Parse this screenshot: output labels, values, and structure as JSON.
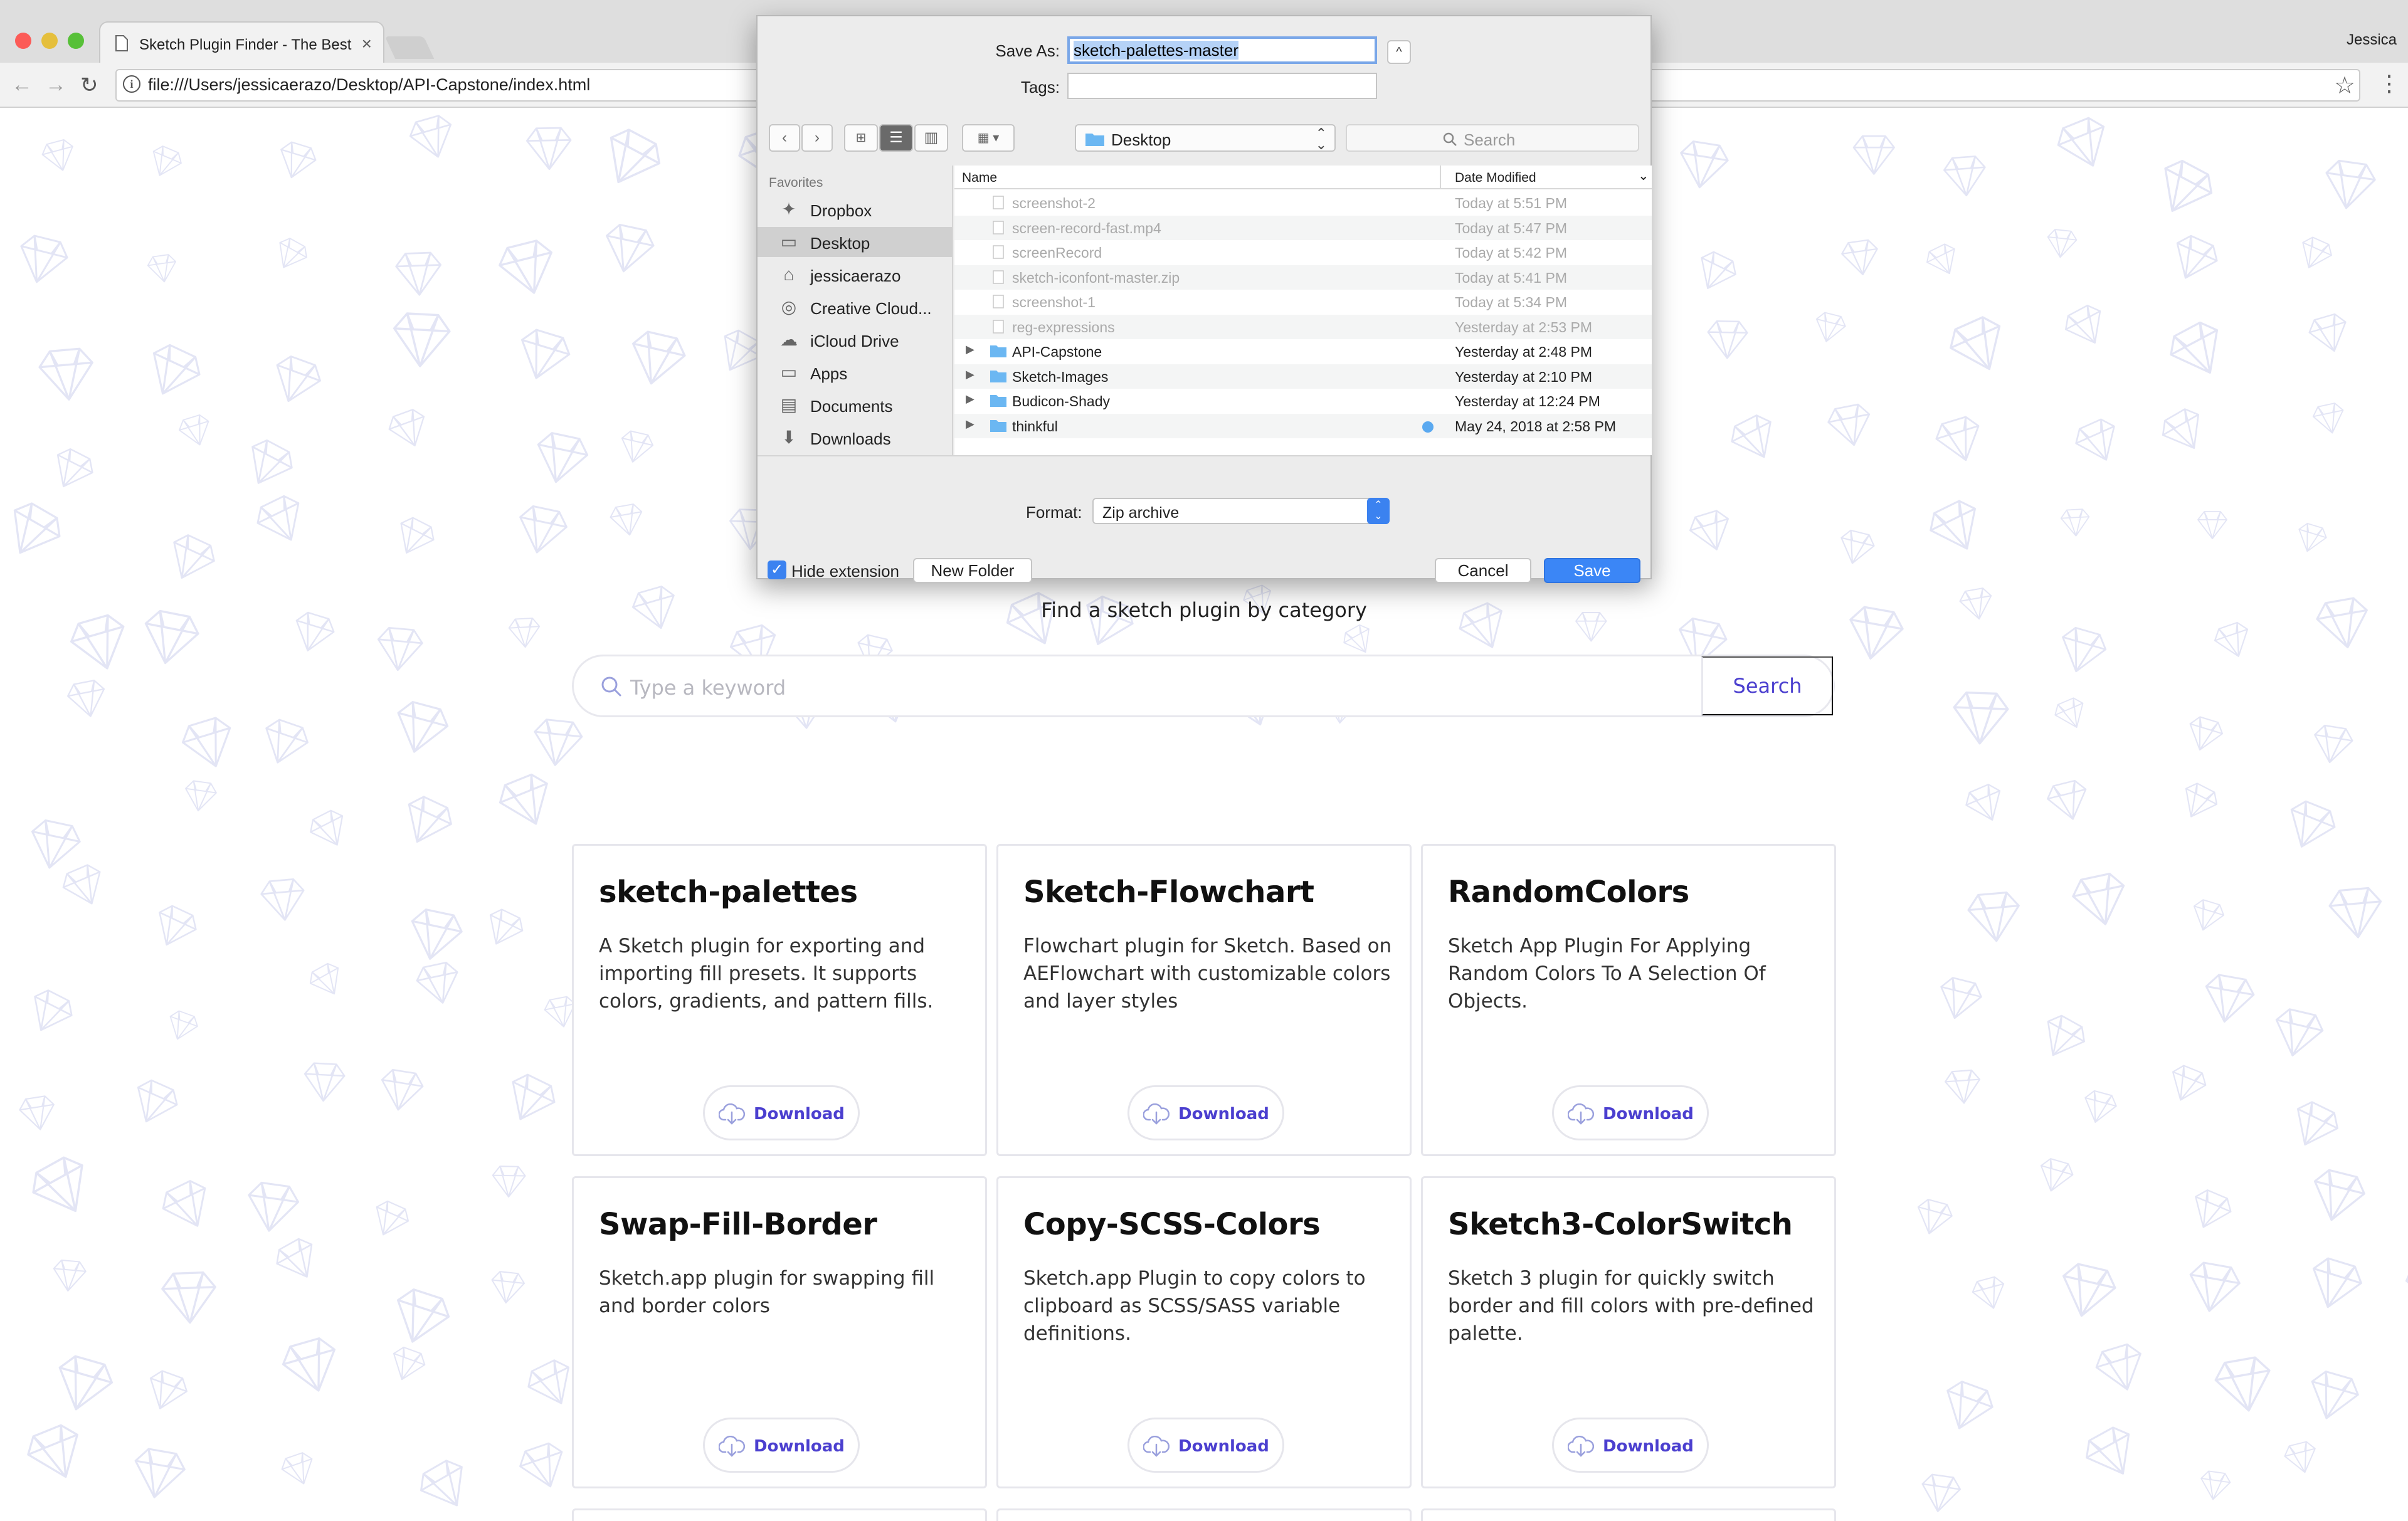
{
  "browser": {
    "tab_title": "Sketch Plugin Finder - The Best",
    "tab_close": "×",
    "profile_name": "Jessica",
    "url": "file:///Users/jessicaerazo/Desktop/API-Capstone/index.html",
    "info_glyph": "i",
    "star_glyph": "☆",
    "menu_glyph": "⋮",
    "back_glyph": "←",
    "forward_glyph": "→",
    "reload_glyph": "↻"
  },
  "page": {
    "subtitle": "Find a sketch plugin by category",
    "search_placeholder": "Type a keyword",
    "search_button": "Search",
    "accent_color": "#4b3fcf",
    "cards": [
      {
        "title": "sketch-palettes",
        "description": "A Sketch plugin for exporting and importing fill presets. It supports colors, gradients, and pattern fills.",
        "button": "Download"
      },
      {
        "title": "Sketch-Flowchart",
        "description": "Flowchart plugin for Sketch. Based on AEFlowchart with customizable colors and layer styles",
        "button": "Download"
      },
      {
        "title": "RandomColors",
        "description": "Sketch App Plugin For Applying Random Colors To A Selection Of Objects.",
        "button": "Download"
      },
      {
        "title": "Swap-Fill-Border",
        "description": "Sketch.app plugin for swapping fill and border colors",
        "button": "Download"
      },
      {
        "title": "Copy-SCSS-Colors",
        "description": "Sketch.app Plugin to copy colors to clipboard as SCSS/SASS variable definitions.",
        "button": "Download"
      },
      {
        "title": "Sketch3-ColorSwitch",
        "description": "Sketch 3 plugin for quickly switch border and fill colors with pre-defined palette.",
        "button": "Download"
      }
    ]
  },
  "dialog": {
    "save_as_label": "Save As:",
    "save_as_value": "sketch-palettes-master",
    "tags_label": "Tags:",
    "collapse_glyph": "^",
    "location": "Desktop",
    "search_placeholder": "Search",
    "favorites_header": "Favorites",
    "sidebar": [
      {
        "label": "Dropbox",
        "icon": "dropbox-icon",
        "glyph": "✦"
      },
      {
        "label": "Desktop",
        "icon": "desktop-icon",
        "glyph": "▭"
      },
      {
        "label": "jessicaerazo",
        "icon": "home-icon",
        "glyph": "⌂"
      },
      {
        "label": "Creative Cloud...",
        "icon": "creative-cloud-icon",
        "glyph": "◎"
      },
      {
        "label": "iCloud Drive",
        "icon": "cloud-icon",
        "glyph": "☁"
      },
      {
        "label": "Apps",
        "icon": "folder-icon",
        "glyph": "▭"
      },
      {
        "label": "Documents",
        "icon": "document-icon",
        "glyph": "▤"
      },
      {
        "label": "Downloads",
        "icon": "download-icon",
        "glyph": "⬇"
      }
    ],
    "columns": {
      "name": "Name",
      "date": "Date Modified"
    },
    "files": [
      {
        "name": "screenshot-2",
        "date": "Today at 5:51 PM",
        "kind": "file",
        "dim": true
      },
      {
        "name": "screen-record-fast.mp4",
        "date": "Today at 5:47 PM",
        "kind": "file",
        "dim": true
      },
      {
        "name": "screenRecord",
        "date": "Today at 5:42 PM",
        "kind": "file",
        "dim": true
      },
      {
        "name": "sketch-iconfont-master.zip",
        "date": "Today at 5:41 PM",
        "kind": "file",
        "dim": true
      },
      {
        "name": "screenshot-1",
        "date": "Today at 5:34 PM",
        "kind": "file",
        "dim": true
      },
      {
        "name": "reg-expressions",
        "date": "Yesterday at 2:53 PM",
        "kind": "file",
        "dim": true
      },
      {
        "name": "API-Capstone",
        "date": "Yesterday at 2:48 PM",
        "kind": "folder",
        "dim": false
      },
      {
        "name": "Sketch-Images",
        "date": "Yesterday at 2:10 PM",
        "kind": "folder",
        "dim": false
      },
      {
        "name": "Budicon-Shady",
        "date": "Yesterday at 12:24 PM",
        "kind": "folder",
        "dim": false
      },
      {
        "name": "thinkful",
        "date": "May 24, 2018 at 2:58 PM",
        "kind": "folder",
        "dim": false,
        "tag_color": "#5aa9f0"
      }
    ],
    "format_label": "Format:",
    "format_value": "Zip archive",
    "hide_extension_label": "Hide extension",
    "new_folder": "New Folder",
    "cancel": "Cancel",
    "save": "Save"
  }
}
